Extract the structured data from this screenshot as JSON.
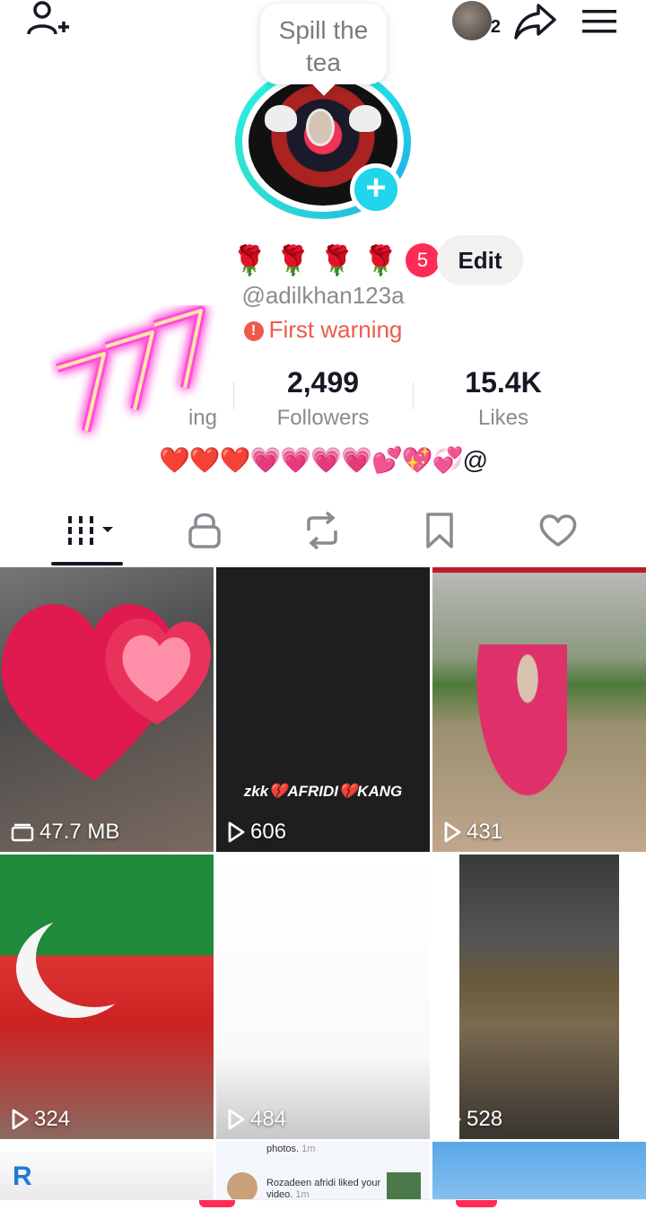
{
  "header": {
    "add_friend_icon": "person-plus-icon",
    "story_count": "2",
    "share_icon": "share-arrow-icon",
    "menu_icon": "hamburger-icon"
  },
  "bubble": {
    "text_line1": "Spill the",
    "text_line2": "tea"
  },
  "profile": {
    "roses": "🌹 🌹 🌹 🌹",
    "rose_badge": "5",
    "edit_label": "Edit",
    "username": "@adilkhan123a",
    "warning": "First warning",
    "bio": "❤️❤️❤️💗💗💗💗💕💖💞@"
  },
  "stats": {
    "following": {
      "value": "",
      "label": "ing"
    },
    "followers": {
      "value": "2,499",
      "label": "Followers"
    },
    "likes": {
      "value": "15.4K",
      "label": "Likes"
    }
  },
  "tabs": [
    "grid-icon",
    "lock-icon",
    "repost-icon",
    "bookmark-icon",
    "heart-icon"
  ],
  "videos": [
    {
      "label": "47.7 MB",
      "kind": "draft"
    },
    {
      "label": "606",
      "kind": "play",
      "caption": "zkk💔AFRIDI💔KANG"
    },
    {
      "label": "431",
      "kind": "play"
    },
    {
      "label": "324",
      "kind": "play"
    },
    {
      "label": "484",
      "kind": "play"
    },
    {
      "label": "528",
      "kind": "play"
    }
  ],
  "bottom_row": {
    "notif1": "photos.",
    "notif1_time": "1m",
    "notif2": "Rozadeen afridi liked your video.",
    "notif2_time": "1m"
  },
  "colors": {
    "accent": "#fe2c55",
    "teal": "#20d5ec",
    "warning": "#ef5a4c"
  }
}
